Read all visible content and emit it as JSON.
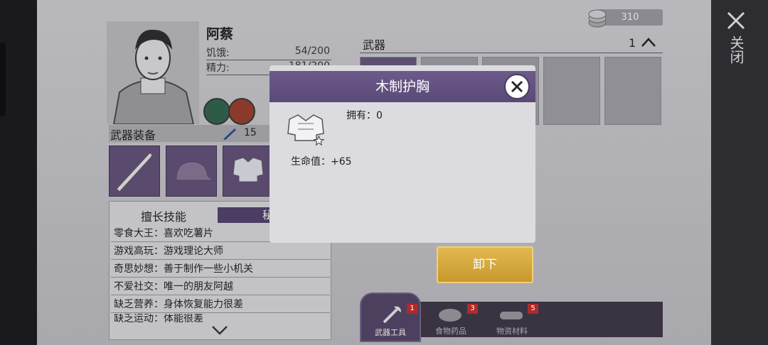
{
  "character": {
    "name": "阿蔡",
    "stats": [
      {
        "label": "饥饿:",
        "value": "54/200"
      },
      {
        "label": "精力:",
        "value": "181/200"
      }
    ]
  },
  "currency": {
    "amount": "310"
  },
  "close": {
    "label": "关闭"
  },
  "equipment": {
    "title": "武器装备",
    "count": "15"
  },
  "skills": {
    "tab_skill": "擅长技能",
    "tab_secret": "秘密",
    "rows": [
      "零食大王：喜欢吃薯片",
      "游戏高玩：游戏理论大师",
      "奇思妙想：善于制作一些小机关",
      "不爱社交：唯一的朋友阿越",
      "缺乏营养：身体恢复能力很差",
      "缺乏运动：体能很差"
    ]
  },
  "weapons": {
    "header": "武器",
    "count": "1"
  },
  "bottom_tabs": [
    {
      "label": "武器工具",
      "badge": "1"
    },
    {
      "label": "食物药品",
      "badge": "3"
    },
    {
      "label": "物资材料",
      "badge": "5"
    }
  ],
  "actions": {
    "unequip": "卸下"
  },
  "modal": {
    "title": "木制护胸",
    "owned_label": "拥有：",
    "owned_value": "0",
    "hp_label": "生命值：",
    "hp_value": "+65"
  }
}
